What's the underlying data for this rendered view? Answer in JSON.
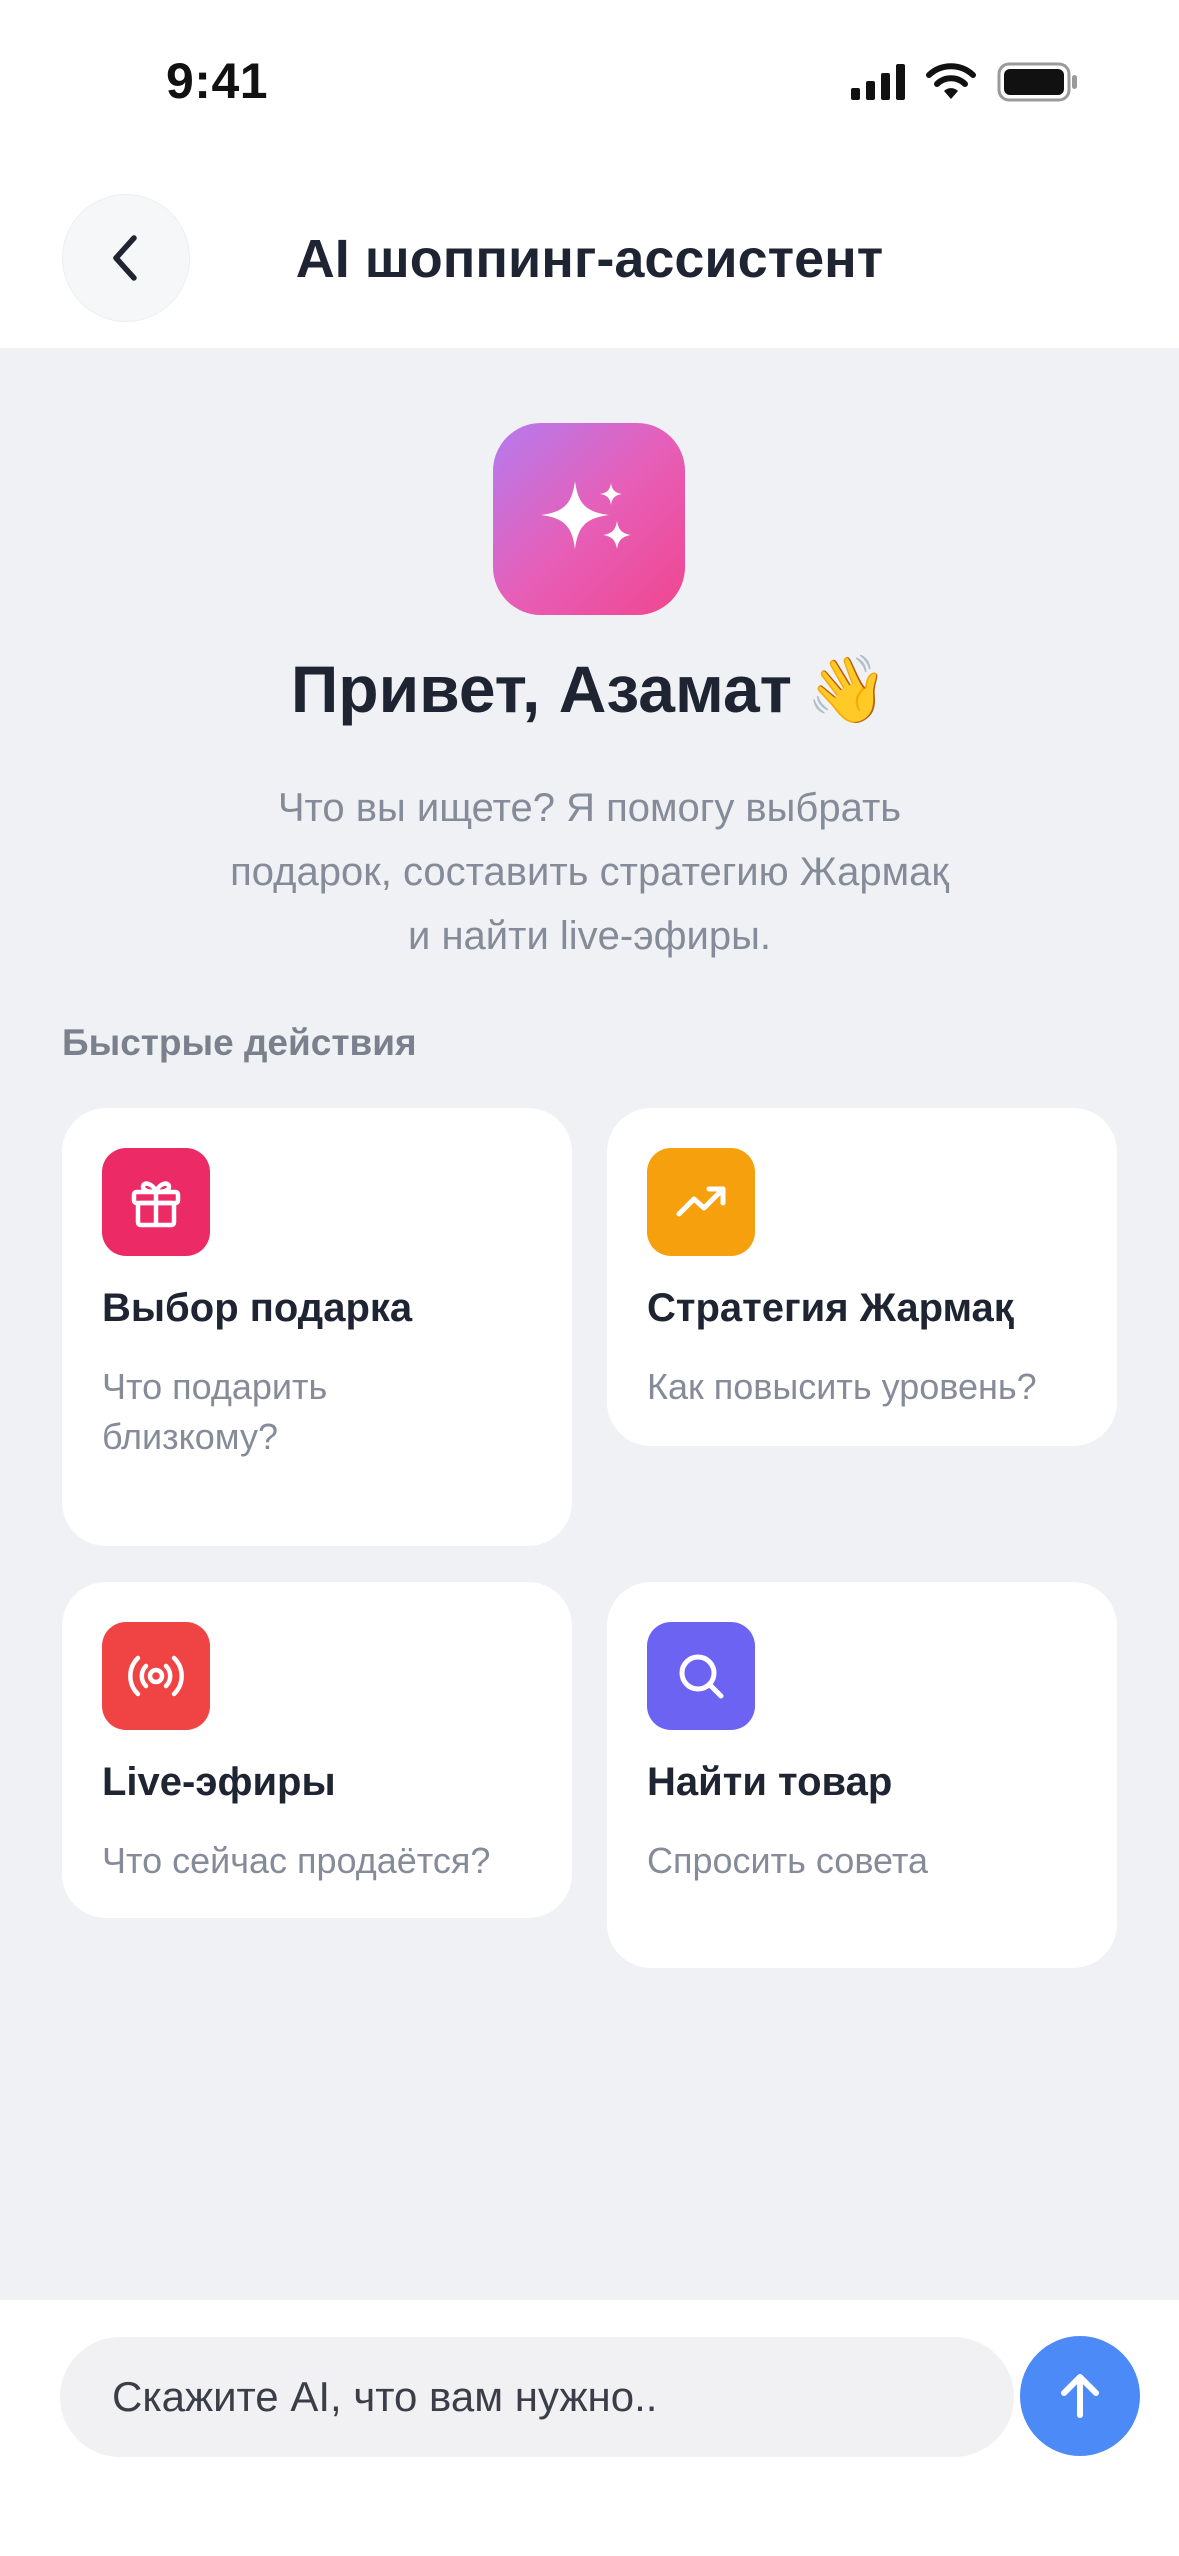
{
  "status_bar": {
    "time": "9:41"
  },
  "header": {
    "title": "AI шоппинг-ассистент",
    "back_icon": "chevron-left-icon"
  },
  "hero": {
    "icon": "sparkles-icon",
    "gradient": [
      "#b57bf0",
      "#f0468e"
    ],
    "greeting": "Привет, Азамат",
    "greeting_emoji": "👋",
    "intro_lines": [
      "Что вы ищете? Я помогу выбрать",
      "подарок, составить стратегию Жармақ",
      "и найти live-эфиры."
    ]
  },
  "quick_actions": {
    "title": "Быстрые действия",
    "items": [
      {
        "title": "Выбор подарка",
        "subtitle_lines": [
          "Что подарить",
          "близкому?"
        ],
        "icon": "gift-icon",
        "color": "#ec2a66"
      },
      {
        "title": "Стратегия Жармақ",
        "subtitle_lines": [
          "Как повысить уровень?"
        ],
        "icon": "trending-up-icon",
        "color": "#f6a00e"
      },
      {
        "title": "Live-эфиры",
        "subtitle_lines": [
          "Что сейчас продаётся?"
        ],
        "icon": "broadcast-icon",
        "color": "#ef4443"
      },
      {
        "title": "Найти товар",
        "subtitle_lines": [
          "Спросить совета"
        ],
        "icon": "search-icon",
        "color": "#6c63f3"
      }
    ]
  },
  "composer": {
    "placeholder": "Скажите AI, что вам нужно..",
    "send_icon": "arrow-up-icon",
    "send_color": "#4c8af7"
  }
}
